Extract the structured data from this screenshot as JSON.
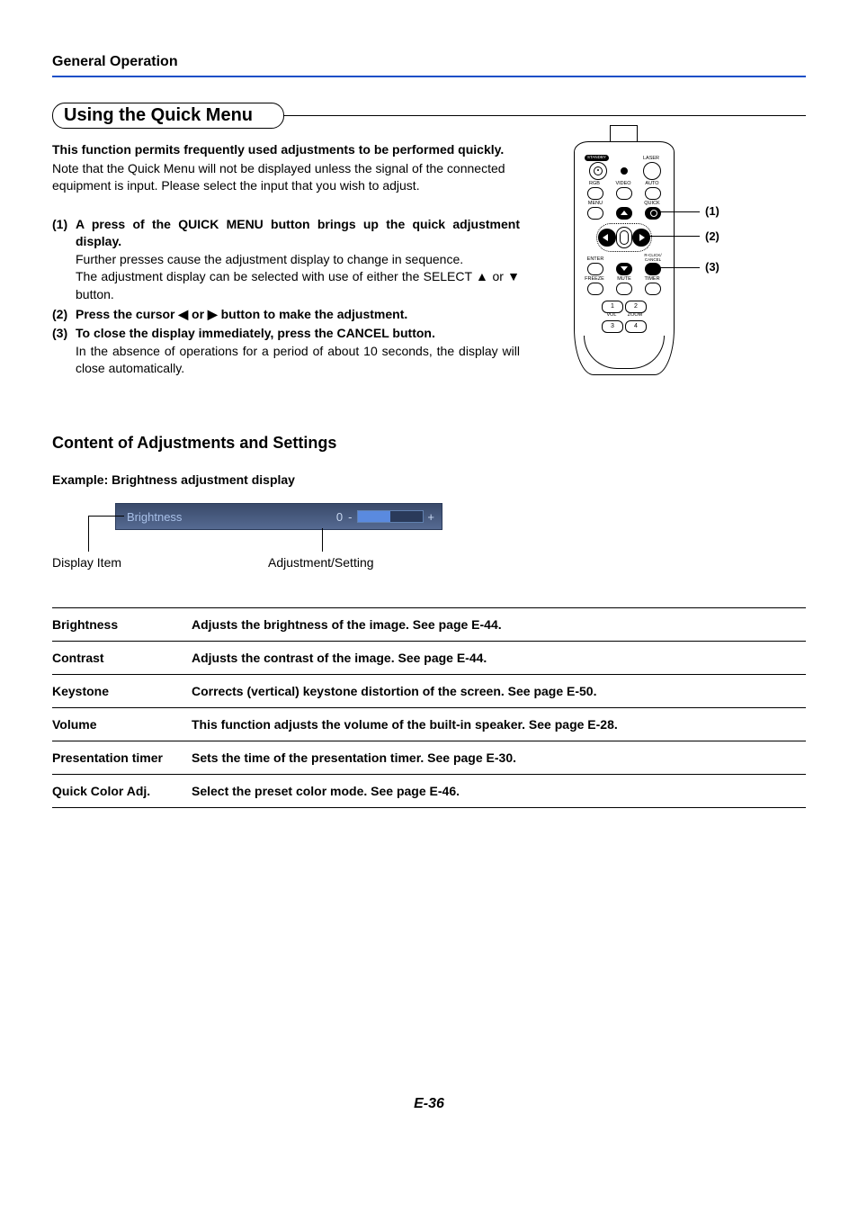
{
  "header": "General Operation",
  "section_title": "Using the Quick Menu",
  "intro": {
    "bold": "This function permits frequently used adjustments to be performed quickly.",
    "text": "Note that the Quick Menu will not be displayed unless the signal of the connected equipment is input. Please select the input that you wish to adjust."
  },
  "steps": [
    {
      "num": "(1)",
      "bold": "A press of the QUICK MENU button brings up the quick adjustment display.",
      "rest": "Further presses cause the adjustment display to change in sequence.\nThe adjustment display can be selected with use of either the SELECT ▲ or ▼ button."
    },
    {
      "num": "(2)",
      "bold": "Press the cursor ◀ or ▶ button to make the adjustment.",
      "rest": ""
    },
    {
      "num": "(3)",
      "bold": "To close the display immediately, press the CANCEL button.",
      "rest": "In the absence of operations for a period of about 10 seconds, the display will close automatically."
    }
  ],
  "remote": {
    "callouts": [
      "(1)",
      "(2)",
      "(3)"
    ],
    "row1": {
      "standby": "STANDBY",
      "laser": "LASER"
    },
    "row2": [
      "RGB",
      "VIDEO",
      "AUTO"
    ],
    "row3": [
      "MENU",
      "",
      "QUICK"
    ],
    "row4": {
      "enter": "ENTER",
      "cancel": "R-CLICK/\nCANCEL"
    },
    "row5": [
      "FREEZE",
      "MUTE",
      "TIMER"
    ],
    "row6": [
      "1",
      "2",
      "3",
      "4"
    ],
    "row6_labels": [
      "VOL",
      "ZOOM"
    ]
  },
  "sub_heading": "Content of Adjustments and Settings",
  "example_label": "Example: Brightness adjustment display",
  "osd": {
    "name": "Brightness",
    "value": "0",
    "minus": "-",
    "plus": "+",
    "caption_left": "Display Item",
    "caption_right": "Adjustment/Setting"
  },
  "settings": [
    {
      "name": "Brightness",
      "desc": "Adjusts the brightness of the image. See page E-44."
    },
    {
      "name": "Contrast",
      "desc": "Adjusts the contrast of the image. See page E-44."
    },
    {
      "name": "Keystone",
      "desc": "Corrects (vertical) keystone distortion of the screen.  See page E-50."
    },
    {
      "name": "Volume",
      "desc": "This function adjusts the volume of the built-in speaker. See page E-28."
    },
    {
      "name": "Presentation timer",
      "desc": "Sets the time of the presentation timer.  See page E-30."
    },
    {
      "name": "Quick Color Adj.",
      "desc": "Select the preset color mode. See page E-46."
    }
  ],
  "page_number": "E-36"
}
